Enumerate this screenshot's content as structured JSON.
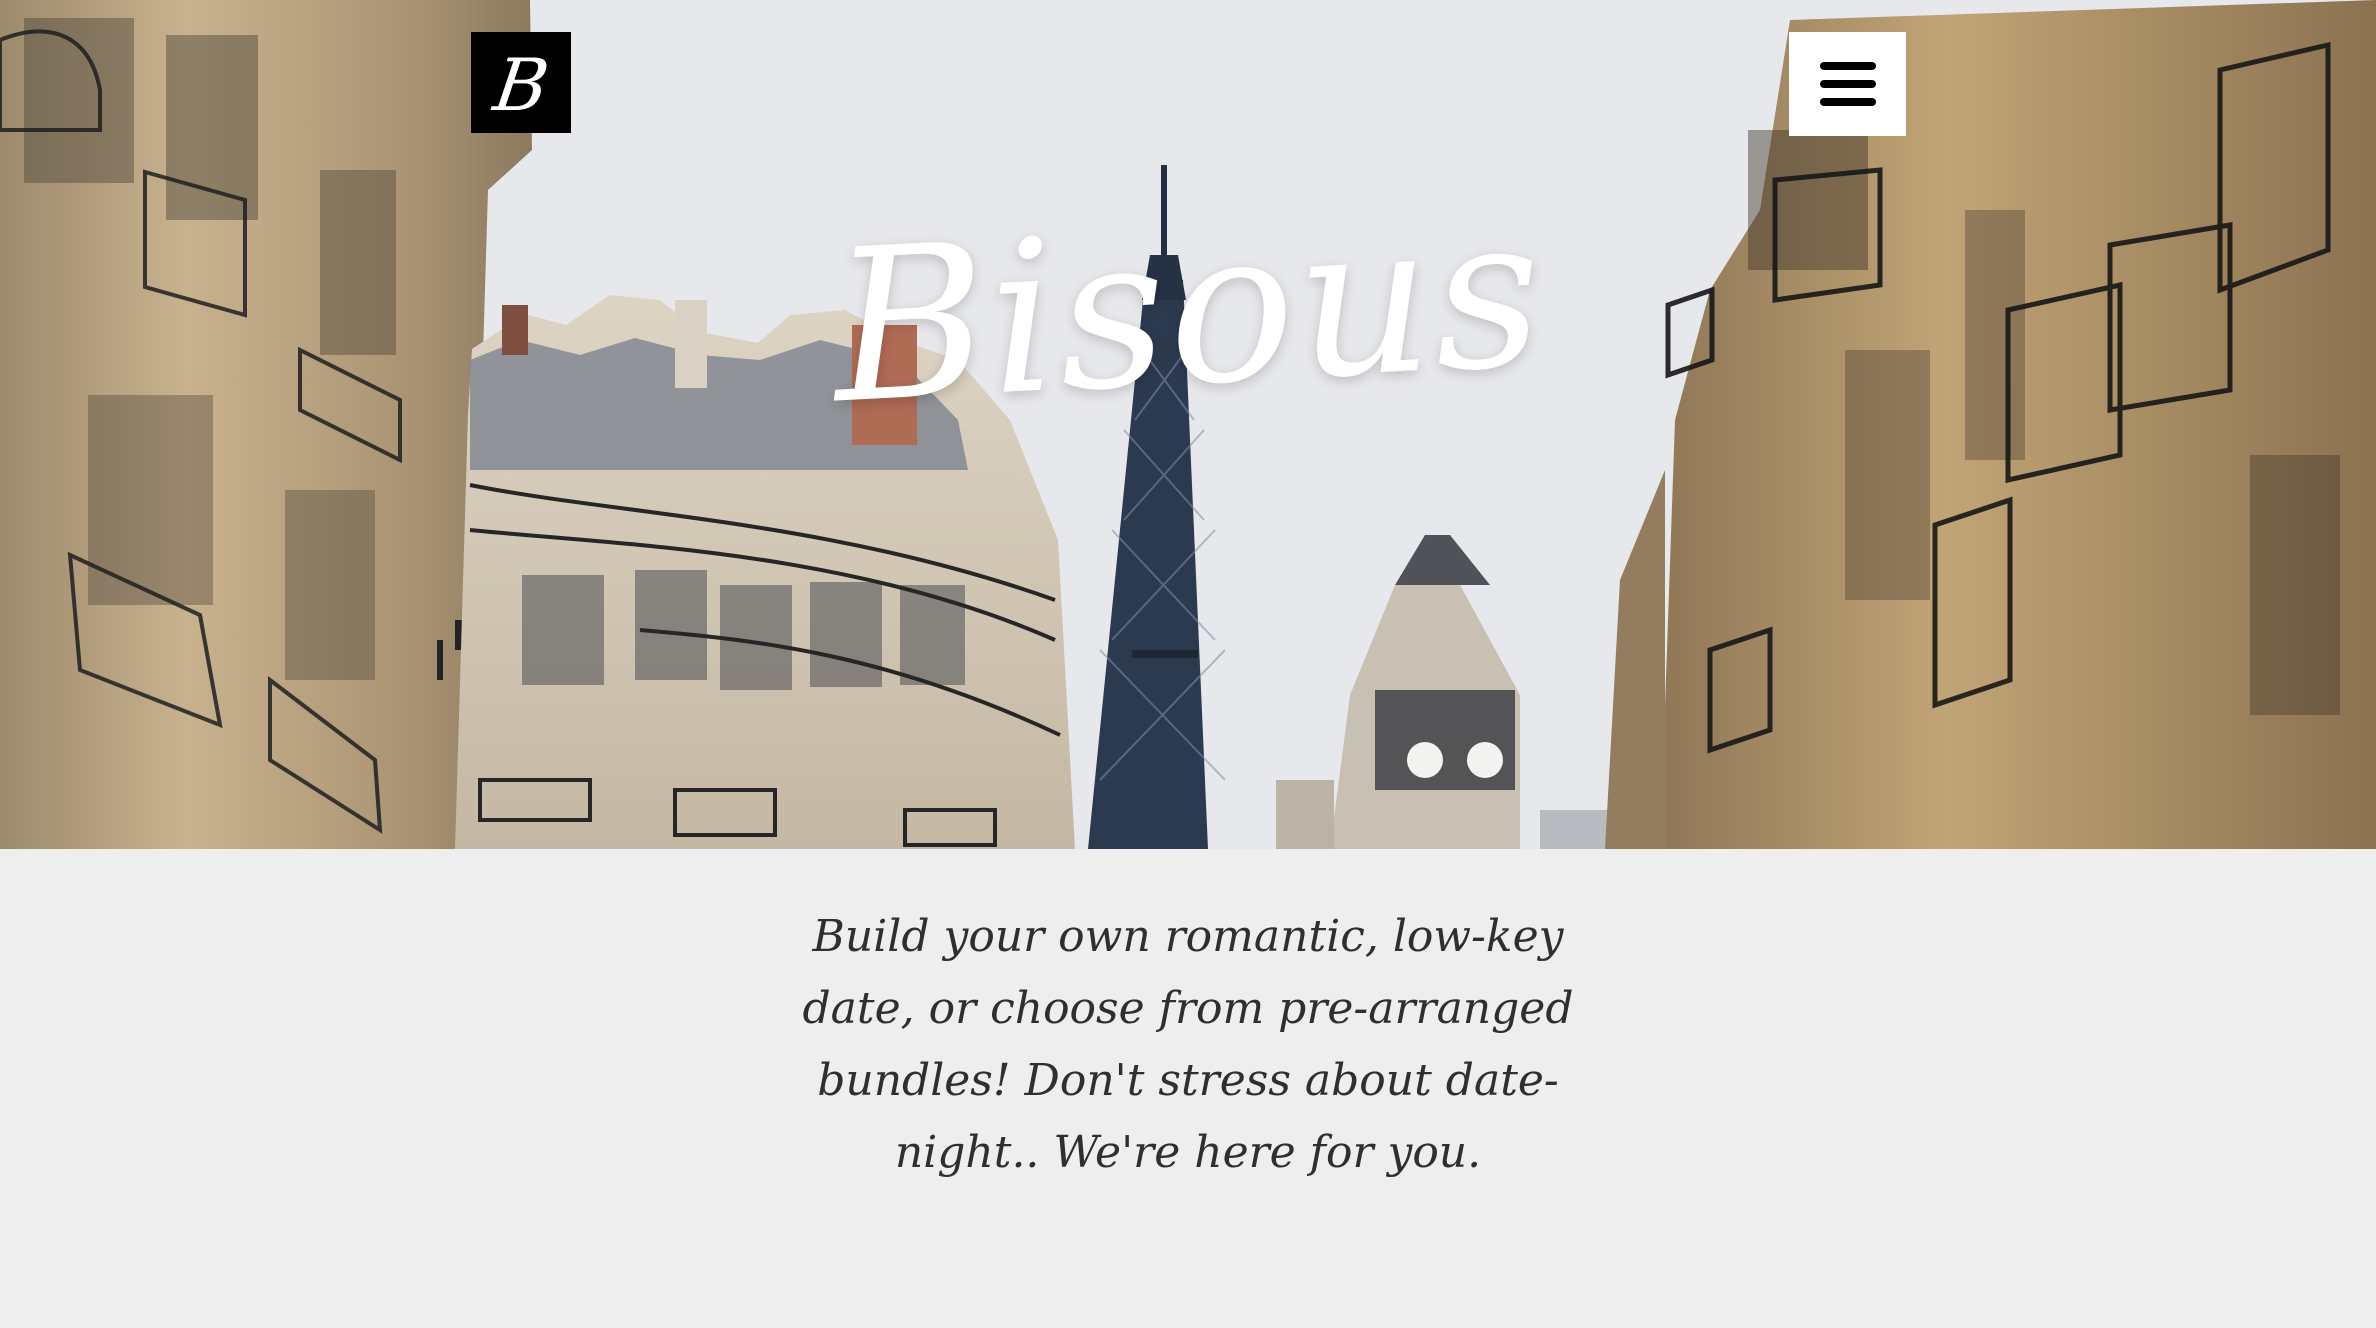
{
  "header": {
    "logo_text": "B",
    "title": "Bisous",
    "menu_icon": "hamburger-menu-icon"
  },
  "main": {
    "tagline": "Build your own romantic, low-key date, or choose from pre-arranged bundles! Don't stress about date-night.. We're here for you."
  },
  "colors": {
    "content_background": "#eeeeee",
    "logo_background": "#000000",
    "menu_background": "#ffffff",
    "title_color": "#ffffff",
    "body_text": "#2f2f2f"
  }
}
